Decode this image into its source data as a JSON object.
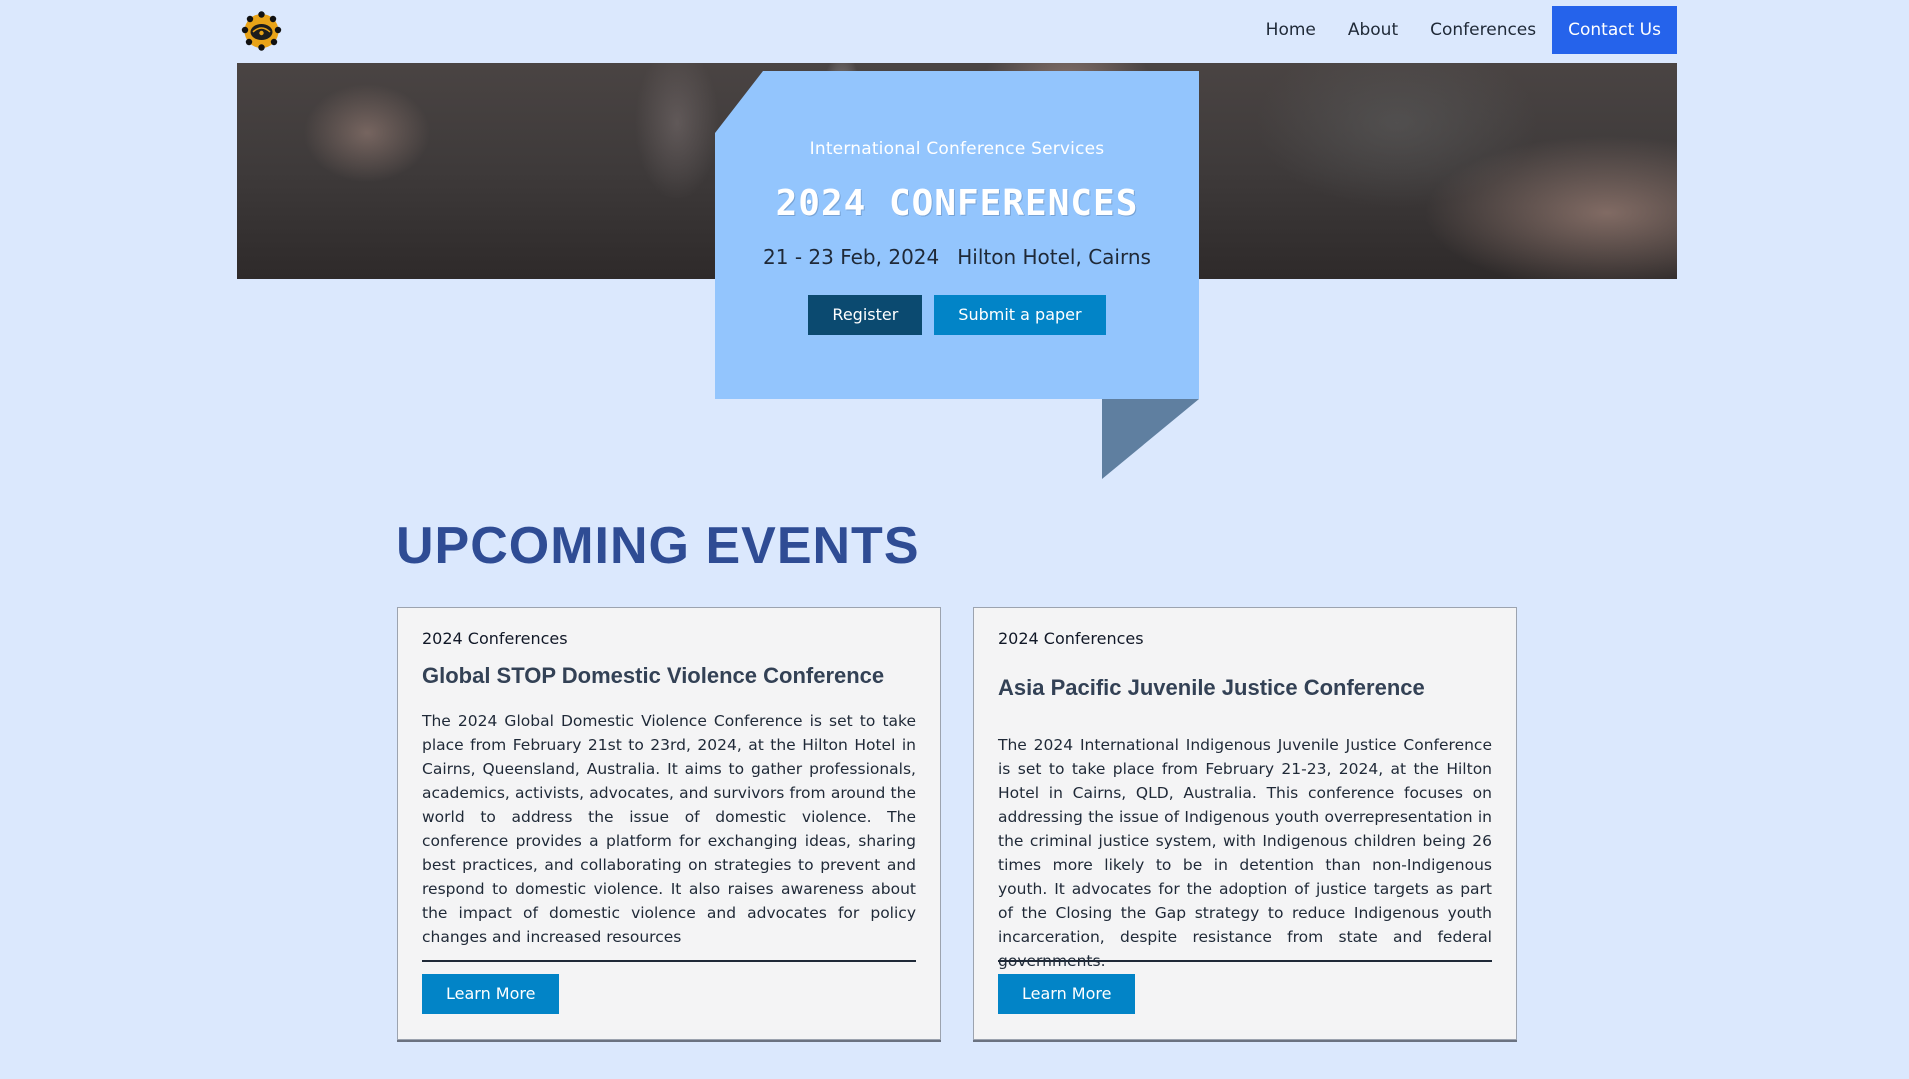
{
  "nav": {
    "logo_icon": "organization-logo-icon",
    "links": [
      "Home",
      "About",
      "Conferences"
    ],
    "cta": "Contact Us"
  },
  "hero": {
    "kicker": "International Conference Services",
    "title": "2024 CONFERENCES",
    "date": "21 - 23 Feb, 2024",
    "venue": "Hilton Hotel, Cairns",
    "register_label": "Register",
    "submit_label": "Submit a paper"
  },
  "upcoming": {
    "title": "UPCOMING EVENTS",
    "cards": [
      {
        "kicker": "2024 Conferences",
        "title": "Global STOP Domestic Violence Conference",
        "body": "The 2024 Global Domestic Violence Conference is set to take place from February 21st to 23rd, 2024, at the Hilton Hotel in Cairns, Queensland, Australia. It aims to gather professionals, academics, activists, advocates, and survivors from around the world to address the issue of domestic violence. The conference provides a platform for exchanging ideas, sharing best practices, and collaborating on strategies to prevent and respond to domestic violence. It also raises awareness about the impact of domestic violence and advocates for policy changes and increased resources",
        "button": "Learn More"
      },
      {
        "kicker": "2024 Conferences",
        "title": "Asia Pacific Juvenile Justice Conference",
        "body": "The 2024 International Indigenous Juvenile Justice Conference is set to take place from February 21-23, 2024, at the Hilton Hotel in Cairns, QLD, Australia. This conference focuses on addressing the issue of Indigenous youth overrepresentation in the criminal justice system, with Indigenous children being 26 times more likely to be in detention than non-Indigenous youth. It advocates for the adoption of justice targets as part of the Closing the Gap strategy to reduce Indigenous youth incarceration, despite resistance from state and federal governments.",
        "button": "Learn More"
      }
    ]
  },
  "colors": {
    "page_bg": "#dbe8fd",
    "cta_blue": "#2563eb",
    "hero_card": "#93c5fd",
    "register_btn": "#0b4a70",
    "accent_btn": "#0284c7",
    "section_title": "#2f4c94"
  }
}
